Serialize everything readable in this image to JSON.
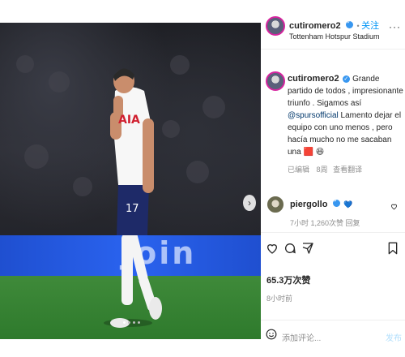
{
  "post_header": {
    "username": "cutiromero2",
    "follow_label": "关注",
    "location": "Tottenham Hotspur Stadium"
  },
  "caption": {
    "username": "cutiromero2",
    "text_part1": "Grande partido de todos , impresionante triunfo . Sigamos así ",
    "mention": "@spursofficial",
    "text_part2": " Lamento dejar el equipo con uno menos , pero hacía mucho no me sacaban una ",
    "emoji_card": "🟥",
    "emoji_face": "😆",
    "edited_label": "已编辑",
    "time_label": "8周",
    "translate_label": "查看翻译"
  },
  "comment": {
    "username": "piergollo",
    "heart": "💙",
    "meta": "7小时  1,260次赞  回复"
  },
  "actions": {
    "likes": "65.3万次赞",
    "time_ago": "8小时前"
  },
  "comment_box": {
    "placeholder": "添加评论...",
    "post_label": "发布"
  },
  "photo": {
    "ad_text": "Join",
    "shirt_text": "AIA",
    "shirt_number": "17",
    "next_arrow": "›"
  }
}
